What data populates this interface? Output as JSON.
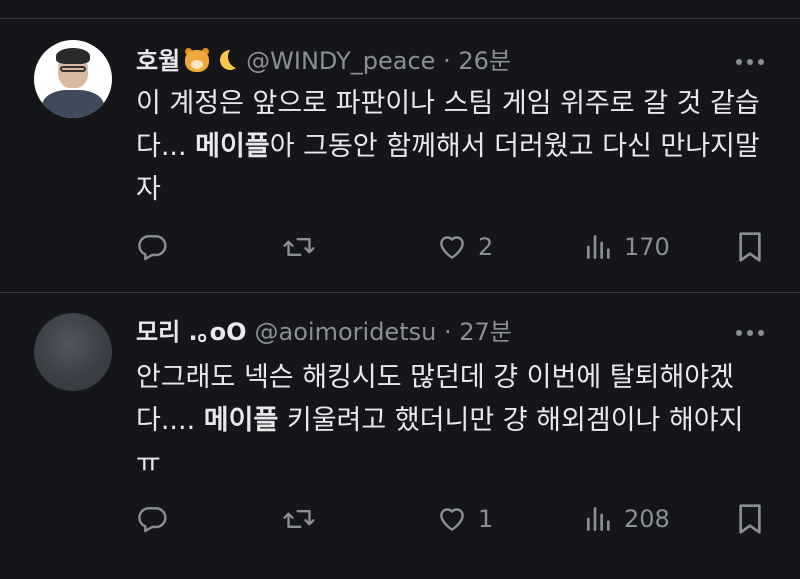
{
  "tweets": [
    {
      "name": "호월",
      "handle": "@WINDY_peace",
      "time": "26분",
      "content_lines": [
        {
          "before": "이 계정은 앞으로 파판이나 스팀 게임 위주로 갈 것 같습",
          "bold": "",
          "after": ""
        },
        {
          "before": "다... ",
          "bold": "메이플",
          "after": "아 그동안 함께해서 더러웠고 다신 만나지말"
        },
        {
          "before": "자",
          "bold": "",
          "after": ""
        }
      ],
      "reply_count": "",
      "retweet_count": "",
      "like_count": "2",
      "view_count": "170",
      "icons": {
        "avatar": "user-photo",
        "badge_1": "tiger-face-emoji",
        "badge_2": "crescent-moon-emoji"
      }
    },
    {
      "name": "모리 .｡oO",
      "handle": "@aoimoridetsu",
      "time": "27분",
      "content_lines": [
        {
          "before": "안그래도 넥슨 해킹시도 많던데 걍 이번에 탈퇴해야겠",
          "bold": "",
          "after": ""
        },
        {
          "before": "다.... ",
          "bold": "메이플",
          "after": " 키울려고 했더니만 걍 해외겜이나 해야지"
        },
        {
          "before": "ㅠ",
          "bold": "",
          "after": ""
        }
      ],
      "reply_count": "",
      "retweet_count": "",
      "like_count": "1",
      "view_count": "208",
      "icons": {
        "avatar": "user-photo"
      }
    }
  ],
  "theme": {
    "background": "#15161a",
    "text": "#e7e9ea",
    "secondary": "#8b8f95",
    "divider": "#38393d"
  }
}
